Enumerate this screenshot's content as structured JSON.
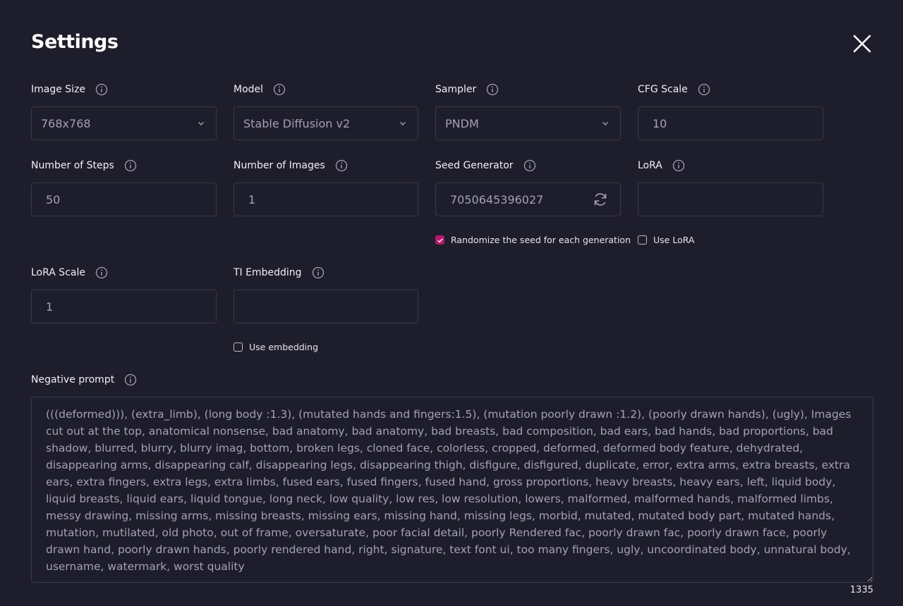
{
  "title": "Settings",
  "fields": {
    "image_size": {
      "label": "Image Size",
      "value": "768x768"
    },
    "model": {
      "label": "Model",
      "value": "Stable Diffusion v2"
    },
    "sampler": {
      "label": "Sampler",
      "value": "PNDM"
    },
    "cfg_scale": {
      "label": "CFG Scale",
      "value": "10"
    },
    "num_steps": {
      "label": "Number of Steps",
      "value": "50"
    },
    "num_images": {
      "label": "Number of Images",
      "value": "1"
    },
    "seed": {
      "label": "Seed Generator",
      "value": "7050645396027"
    },
    "lora": {
      "label": "LoRA",
      "value": ""
    },
    "lora_scale": {
      "label": "LoRA Scale",
      "value": "1"
    },
    "ti_embedding": {
      "label": "TI Embedding",
      "value": ""
    },
    "negative_prompt": {
      "label": "Negative prompt",
      "value": "(((deformed))), (extra_limb), (long body :1.3), (mutated hands and fingers:1.5), (mutation poorly drawn :1.2), (poorly drawn hands), (ugly), Images cut out at the top, anatomical nonsense, bad anatomy, bad anatomy, bad breasts, bad composition, bad ears, bad hands, bad proportions, bad shadow, blurred, blurry, blurry imag, bottom, broken legs, cloned face, colorless, cropped, deformed, deformed body feature, dehydrated, disappearing arms, disappearing calf, disappearing legs, disappearing thigh, disfigure, disfigured, duplicate, error, extra arms, extra breasts, extra ears, extra fingers, extra legs, extra limbs, fused ears, fused fingers, fused hand, gross proportions, heavy breasts, heavy ears, left, liquid body, liquid breasts, liquid ears, liquid tongue, long neck, low quality, low res, low resolution, lowers, malformed, malformed hands, malformed limbs, messy drawing, missing arms, missing breasts, missing ears, missing hand, missing legs, morbid, mutated, mutated body part, mutated hands, mutation, mutilated, old photo, out of frame, oversaturate, poor facial detail, poorly Rendered fac, poorly drawn fac, poorly drawn face, poorly drawn hand, poorly drawn hands, poorly rendered hand, right, signature, text font ui, too many fingers, ugly, uncoordinated body, unnatural body, username, watermark, worst quality",
      "count": "1335"
    }
  },
  "checkboxes": {
    "randomize_seed": {
      "label": "Randomize the seed for each generation",
      "checked": true
    },
    "use_lora": {
      "label": "Use LoRA",
      "checked": false
    },
    "use_embedding": {
      "label": "Use embedding",
      "checked": false
    }
  },
  "icons": {
    "close": "close-icon",
    "info": "info-icon",
    "chevron": "chevron-down-icon",
    "refresh": "refresh-icon"
  },
  "colors": {
    "background": "#1e1d2b",
    "border": "#3a3949",
    "accent": "#b5196a",
    "value_text": "#a3a2b2"
  }
}
